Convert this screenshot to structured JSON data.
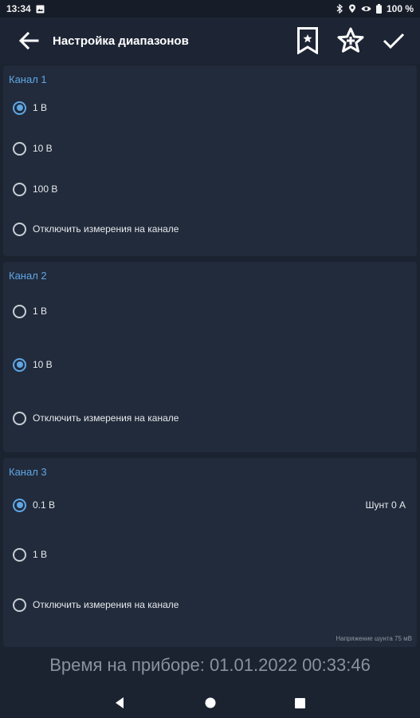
{
  "status_bar": {
    "time": "13:34",
    "battery": "100 %"
  },
  "app_bar": {
    "title": "Настройка диапазонов",
    "icons": [
      "arrow-back-icon",
      "bookmark-star-icon",
      "star-add-icon",
      "check-icon"
    ]
  },
  "channels": [
    {
      "title": "Канал 1",
      "options": [
        {
          "label": "1 В",
          "checked": true
        },
        {
          "label": "10 В",
          "checked": false
        },
        {
          "label": "100 В",
          "checked": false
        },
        {
          "label": "Отключить измерения на канале",
          "checked": false
        }
      ]
    },
    {
      "title": "Канал 2",
      "options": [
        {
          "label": "1 В",
          "checked": false
        },
        {
          "label": "10 В",
          "checked": true
        },
        {
          "label": "Отключить измерения на канале",
          "checked": false
        }
      ]
    },
    {
      "title": "Канал 3",
      "options": [
        {
          "label": "0.1 В",
          "checked": true,
          "side_text": "Шунт 0 А"
        },
        {
          "label": "1 В",
          "checked": false
        },
        {
          "label": "Отключить измерения на канале",
          "checked": false
        }
      ],
      "note": "Напряжение шунта 75 мВ"
    }
  ],
  "device_time": "Время на приборе: 01.01.2022 00:33:46",
  "colors": {
    "background": "#1b2230",
    "card": "#222b3b",
    "accent": "#5fa7e6"
  }
}
